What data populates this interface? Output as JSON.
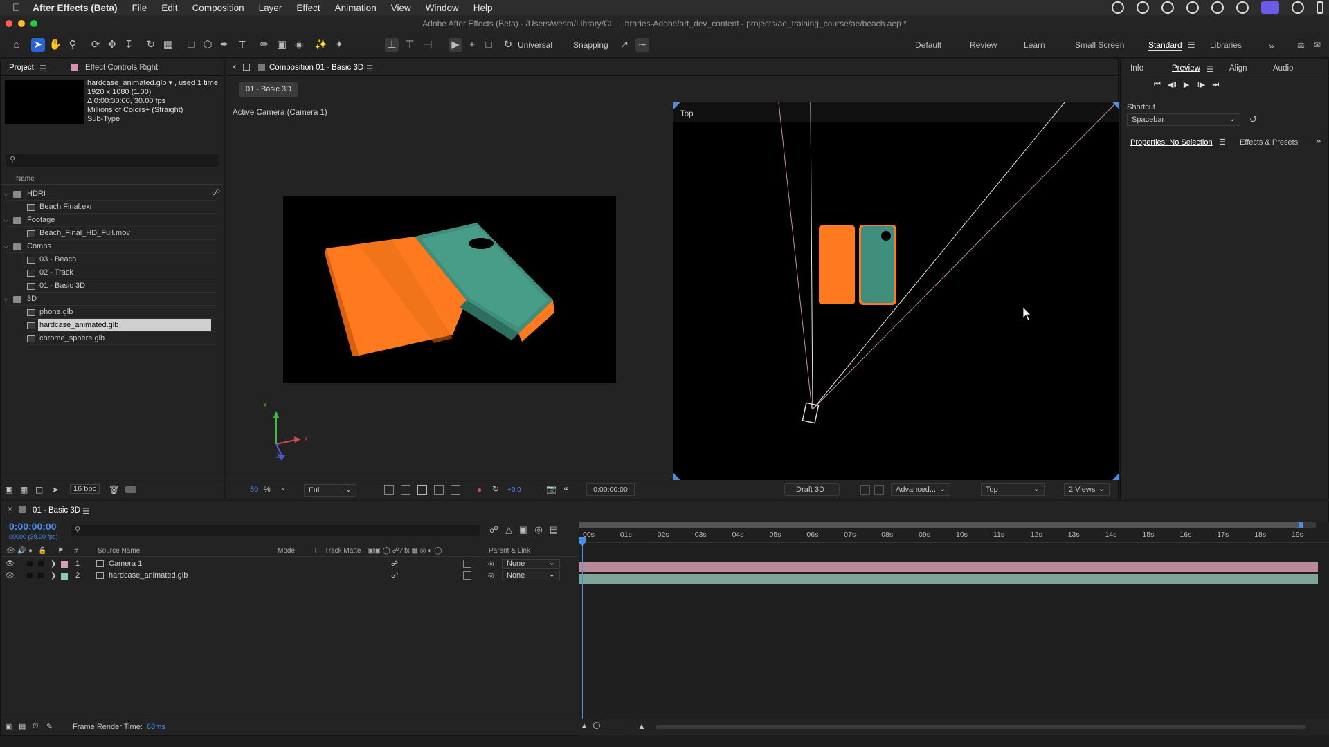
{
  "menubar": {
    "app": "After Effects (Beta)",
    "items": [
      "File",
      "Edit",
      "Composition",
      "Layer",
      "Effect",
      "Animation",
      "View",
      "Window",
      "Help"
    ]
  },
  "window_title": "Adobe After Effects (Beta) - /Users/wesm/Library/Cl ... ibraries-Adobe/art_dev_content - projects/ae_training_course/ae/beach.aep *",
  "toolbar": {
    "universal_label": "Universal",
    "snapping_label": "Snapping",
    "workspaces": [
      "Default",
      "Review",
      "Learn",
      "Small Screen",
      "Standard",
      "Libraries"
    ],
    "active_workspace": "Standard"
  },
  "project_panel": {
    "tab_project": "Project",
    "tab_effect_controls": "Effect Controls Right",
    "item_name": "hardcase_animated.glb ▾ , used 1 time",
    "item_size": "1920 x 1080 (1.00)",
    "item_duration": "Δ 0:00:30:00, 30.00 fps",
    "item_colors": "Millions of Colors+ (Straight)",
    "item_subtype": "Sub-Type",
    "search_placeholder": "",
    "col_name": "Name",
    "tree": [
      {
        "label": "HDRI",
        "type": "folder",
        "level": 0
      },
      {
        "label": "Beach Final.exr",
        "type": "file",
        "level": 1
      },
      {
        "label": "Footage",
        "type": "folder",
        "level": 0
      },
      {
        "label": "Beach_Final_HD_Full.mov",
        "type": "file",
        "level": 1
      },
      {
        "label": "Comps",
        "type": "folder",
        "level": 0
      },
      {
        "label": "03 - Beach",
        "type": "comp",
        "level": 1
      },
      {
        "label": "02 - Track",
        "type": "comp",
        "level": 1
      },
      {
        "label": "01 - Basic 3D",
        "type": "comp",
        "level": 1
      },
      {
        "label": "3D",
        "type": "folder",
        "level": 0
      },
      {
        "label": "phone.glb",
        "type": "file",
        "level": 1
      },
      {
        "label": "hardcase_animated.glb",
        "type": "file",
        "level": 1,
        "selected": true
      },
      {
        "label": "chrome_sphere.glb",
        "type": "file",
        "level": 1
      }
    ],
    "bpc": "16 bpc"
  },
  "comp_panel": {
    "tab": "Composition 01 - Basic 3D",
    "chip": "01 - Basic 3D",
    "left_view_label": "Active Camera (Camera 1)",
    "right_view_label": "Top",
    "zoom": "50",
    "zoom_suffix": "%",
    "resolution": "Full",
    "exposure": "+0.0",
    "timecode": "0:00:00:00",
    "draft": "Draft 3D",
    "renderer": "Advanced...",
    "view": "Top",
    "views_count": "2 Views",
    "axis": {
      "x": "X",
      "y": "Y",
      "z": "Z"
    }
  },
  "right_panel": {
    "tabs": [
      "Info",
      "Preview",
      "Align",
      "Audio"
    ],
    "active_tab": "Preview",
    "shortcut_label": "Shortcut",
    "shortcut_value": "Spacebar",
    "properties_tab": "Properties: No Selection",
    "effects_tab": "Effects & Presets"
  },
  "timeline": {
    "tab": "01 - Basic 3D",
    "timecode": "0:00:00:00",
    "frames": "00000 (30.00 fps)",
    "columns": {
      "num": "#",
      "source": "Source Name",
      "mode": "Mode",
      "t": "T",
      "track": "Track Matte",
      "parent": "Parent & Link"
    },
    "layers": [
      {
        "num": "1",
        "name": "Camera 1",
        "color": "#d6a0b0",
        "parent": "None",
        "bar": "#b98a98"
      },
      {
        "num": "2",
        "name": "hardcase_animated.glb",
        "color": "#8fc9b8",
        "parent": "None",
        "bar": "#7ea59a"
      }
    ],
    "ruler": [
      "00s",
      "01s",
      "02s",
      "03s",
      "04s",
      "05s",
      "06s",
      "07s",
      "08s",
      "09s",
      "10s",
      "11s",
      "12s",
      "13s",
      "14s",
      "15s",
      "16s",
      "17s",
      "18s",
      "19s"
    ],
    "frame_render_label": "Frame Render Time:",
    "frame_render_value": "68ms"
  },
  "colors": {
    "accent": "#2c64d8",
    "orange": "#ff7a1f",
    "teal": "#3f8f7c",
    "camera_layer": "#b98a98"
  }
}
